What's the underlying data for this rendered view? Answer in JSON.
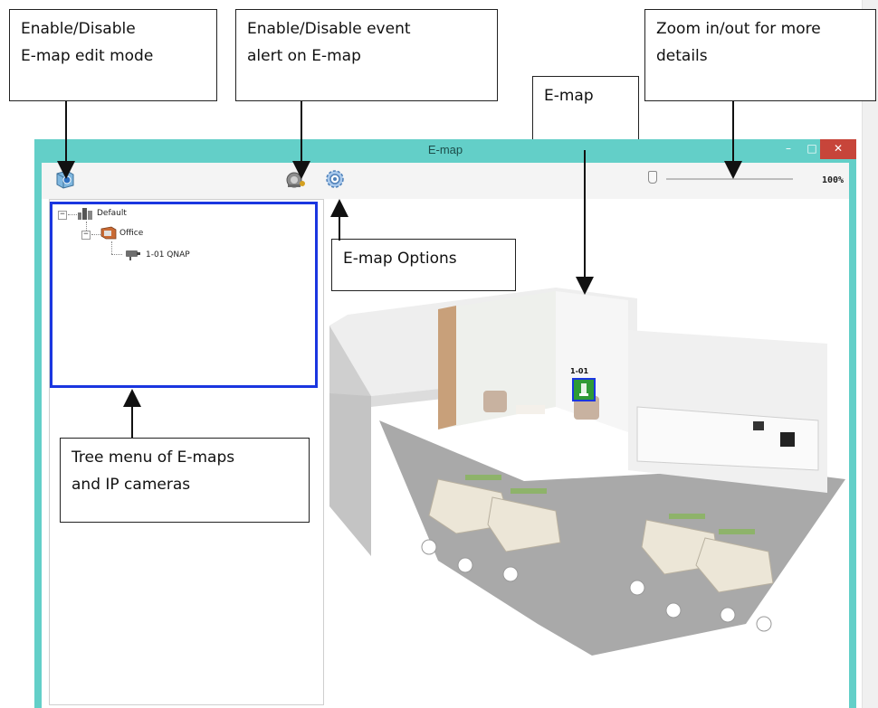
{
  "callouts": {
    "edit_mode": {
      "line1": "Enable/Disable",
      "line2": "E-map edit mode"
    },
    "event_alert": {
      "line1": "Enable/Disable event",
      "line2": "alert on E-map"
    },
    "emap": {
      "line1": "E-map"
    },
    "zoom": {
      "line1": "Zoom in/out for more",
      "line2": "details"
    },
    "options": {
      "line1": "E-map Options"
    },
    "tree": {
      "line1": "Tree menu of E-maps",
      "line2": "and IP cameras"
    }
  },
  "window": {
    "title": "E-map",
    "minimize_glyph": "–",
    "maximize_glyph": "□",
    "close_glyph": "✕",
    "title_bar_color": "#63cfc8"
  },
  "toolbar": {
    "edit_mode_icon": "map-edit-icon",
    "event_alert_icon": "alarm-bell-icon",
    "options_icon": "gear-icon",
    "zoom_value": "100%",
    "zoom_level": 1.0
  },
  "tree": {
    "root": "Default",
    "child": "Office",
    "camera": "1-01 QNAP",
    "highlight_color": "#1a36e0"
  },
  "map": {
    "camera_label": "1-01",
    "camera_icon": "camera-marker-icon"
  }
}
